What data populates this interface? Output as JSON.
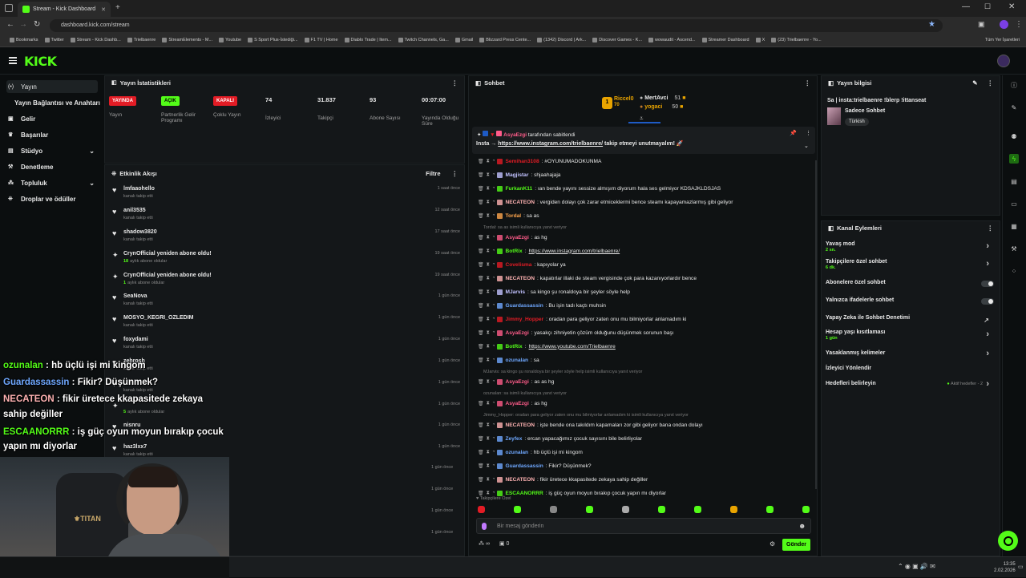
{
  "browser": {
    "tab_title": "Stream - Kick Dashboard",
    "url": "dashboard.kick.com/stream",
    "bookmarks": [
      "Bookmarks",
      "Twitter",
      "Stream - Kick Dashb...",
      "Trielbaenre",
      "StreamElements - M...",
      "Youtube",
      "S Sport Plus-İstediği...",
      "F1 TV | Home",
      "Diablo Trade | Item...",
      "Twitch Channels, Ga...",
      "Gmail",
      "Blizzard Press Cente...",
      "(1342) Discord | Ark...",
      "Discover Games - K...",
      "wowaudit - Ascend...",
      "Streamer Dashboard",
      "X",
      "(23) Trielbaenre - Yo..."
    ],
    "all_bookmarks": "Tüm Yer İşaretleri"
  },
  "sidebar": {
    "items": [
      {
        "label": "Yayın",
        "icon": "broadcast-icon"
      },
      {
        "label": "Yayın Bağlantısı ve Anahtarı",
        "icon": ""
      },
      {
        "label": "Gelir",
        "icon": "money-icon"
      },
      {
        "label": "Başarılar",
        "icon": "trophy-icon"
      },
      {
        "label": "Stüdyo",
        "icon": "studio-icon"
      },
      {
        "label": "Denetleme",
        "icon": "hammer-icon"
      },
      {
        "label": "Topluluk",
        "icon": "community-icon"
      },
      {
        "label": "Droplar ve ödüller",
        "icon": "gift-icon"
      }
    ]
  },
  "stats": {
    "title": "Yayın İstatistikleri",
    "items": [
      {
        "value": "YAYINDA",
        "label": "Yayın",
        "color": "#e31c25",
        "type": "badge"
      },
      {
        "value": "AÇIK",
        "label": "Partnerlik Gelir Programı",
        "color": "#53fc18",
        "type": "badge"
      },
      {
        "value": "KAPALI",
        "label": "Çoklu Yayın",
        "color": "#e31c25",
        "type": "badge"
      },
      {
        "value": "74",
        "label": "İzleyici",
        "type": "num"
      },
      {
        "value": "31.837",
        "label": "Takipçi",
        "type": "num"
      },
      {
        "value": "93",
        "label": "Abone Sayısı",
        "type": "num"
      },
      {
        "value": "00:07:00",
        "label": "Yayında Olduğu Süre",
        "type": "num"
      }
    ]
  },
  "activity": {
    "title": "Etkinlik Akışı",
    "filter": "Filtre",
    "rows": [
      {
        "name": "lmfaaohello",
        "sub": "kanalı takip etti",
        "time": "1 saat önce",
        "kind": "follow"
      },
      {
        "name": "anil3535",
        "sub": "kanalı takip etti",
        "time": "12 saat önce",
        "kind": "follow"
      },
      {
        "name": "shadow3820",
        "sub": "kanalı takip etti",
        "time": "17 saat önce",
        "kind": "follow"
      },
      {
        "name": "CrynOfficial yeniden abone oldu!",
        "sub_num": "18",
        "sub": "aylık abone oldular",
        "time": "19 saat önce",
        "kind": "sub"
      },
      {
        "name": "CrynOfficial yeniden abone oldu!",
        "sub_num": "1",
        "sub": "aylık abone oldular",
        "time": "19 saat önce",
        "kind": "sub"
      },
      {
        "name": "SeaNova",
        "sub": "kanalı takip etti",
        "time": "1 gün önce",
        "kind": "follow"
      },
      {
        "name": "MOSYO_KEGRI_OZLEDIM",
        "sub": "kanalı takip etti",
        "time": "1 gün önce",
        "kind": "follow"
      },
      {
        "name": "foxydami",
        "sub": "kanalı takip etti",
        "time": "1 gün önce",
        "kind": "follow"
      },
      {
        "name": "zehrosh",
        "sub": "kanalı takip etti",
        "time": "1 gün önce",
        "kind": "follow"
      },
      {
        "name": "",
        "sub": "kanalı takip etti",
        "time": "1 gün önce",
        "kind": "follow"
      },
      {
        "name": "",
        "sub_num": "5",
        "sub": "aylık abone oldular",
        "time": "1 gün önce",
        "kind": "sub"
      },
      {
        "name": "nisnru",
        "sub": "",
        "time": "1 gün önce",
        "kind": "follow"
      },
      {
        "name": "haz3lxx7",
        "sub": "kanalı takip etti",
        "time": "1 gün önce",
        "kind": "follow"
      }
    ],
    "more_times": [
      "1 gün önce",
      "1 gün önce",
      "1 gün önce",
      "1 gün önce"
    ]
  },
  "chat": {
    "title": "Sohbet",
    "top_users": [
      {
        "name": "Riccel0",
        "count": "70",
        "color": "#e9a400"
      },
      {
        "name": "MertAvci",
        "count": "51"
      },
      {
        "name": "yogaci",
        "count": "50"
      }
    ],
    "pinned": {
      "by": "AsyaEzgi",
      "by_suffix": "tarafından sabitlendi",
      "prefix": "Insta →",
      "link": "https://www.instagram.com/trielbaenre/",
      "suffix": "takip etmeyi unutmayalım!"
    },
    "messages": [
      {
        "user": "Semihan3108",
        "color": "#e31c25",
        "text": ": #OYUNUMADOKUNMA"
      },
      {
        "user": "Magjistar",
        "color": "#c2c2ff",
        "text": ": shjaahajaja"
      },
      {
        "user": "FurkanK11",
        "color": "#53fc18",
        "text": ": ıan bende yayını sessize almışım diyorum hala ses gelmiyor KDSAJKLDSJAS"
      },
      {
        "user": "NECATEON",
        "color": "#ffb3b3",
        "text": ": vergiden dolayı çok zarar etmiceklermi bence steamı kapayamazlarmış gibi geliyor"
      },
      {
        "user": "Tordal",
        "color": "#ffa64d",
        "text": ": sa as"
      },
      {
        "reply": "Tordal: sa as isimli kullanıcıya yanıt veriyor"
      },
      {
        "user": "AsyaEzgi",
        "color": "#ff5c8a",
        "text": ": as hg"
      },
      {
        "user": "BotRix",
        "color": "#53fc18",
        "text": ": ",
        "link": "https://www.instagram.com/trielbaenre/"
      },
      {
        "user": "Covelisma",
        "color": "#e31c25",
        "text": ": kapıyolar ya"
      },
      {
        "user": "NECATEON",
        "color": "#ffb3b3",
        "text": ": kapatırlar illaki de steam vergisinde çok para kazanıyorlardır bence"
      },
      {
        "user": "MJarvis",
        "color": "#c2c2ff",
        "text": ": sa kingo şu ronaldoya bir şeyler söyle help"
      },
      {
        "user": "Guardassassin",
        "color": "#6fa8ff",
        "text": ": Bu işin tadı kaçtı muhsin"
      },
      {
        "user": "Jimmy_Hopper",
        "color": "#e31c25",
        "text": ": oradan para geliyor zaten onu mu bilmiyorlar anlamadım ki"
      },
      {
        "user": "AsyaEzgi",
        "color": "#ff5c8a",
        "text": ": yasakçı zihniyetin çözüm olduğunu düşünmek sorunun başı"
      },
      {
        "user": "BotRix",
        "color": "#53fc18",
        "text": ": ",
        "link": "https://www.youtube.com/Trielbaenre"
      },
      {
        "user": "ozunalan",
        "color": "#6fa8ff",
        "text": ": sa"
      },
      {
        "reply": "MJarvis: sa kingo şu ronaldoya bir şeyler söyle help isimli kullanıcıya yanıt veriyor"
      },
      {
        "user": "AsyaEzgi",
        "color": "#ff5c8a",
        "text": ": as as hg"
      },
      {
        "reply": "ozunalan: sa isimli kullanıcıya yanıt veriyor"
      },
      {
        "user": "AsyaEzgi",
        "color": "#ff5c8a",
        "text": ": as hg"
      },
      {
        "reply": "Jimmy_Hopper: oradan para geliyor zaten onu mu bilmiyorlar anlamadım ki isimli kullanıcıya yanıt veriyor"
      },
      {
        "user": "NECATEON",
        "color": "#ffb3b3",
        "text": ": işte bende ona takıldım kapamaları zor gibi geliyor bana ondan dolayı"
      },
      {
        "user": "Zeyfex",
        "color": "#6fa8ff",
        "text": ": ercan yapacağımız çocuk sayısını bile belirliyolar"
      },
      {
        "user": "ozunalan",
        "color": "#6fa8ff",
        "text": ": hb üçlü işi mi kingom"
      },
      {
        "user": "Guardassassin",
        "color": "#6fa8ff",
        "text": ": Fikir? Düşünmek?"
      },
      {
        "user": "NECATEON",
        "color": "#ffb3b3",
        "text": ": fikir üretece kkapasitede zekaya sahip değiller"
      },
      {
        "user": "ESCAANORRR",
        "color": "#53fc18",
        "text": ": iş güç oyun moyun bırakıp çocuk yapın mı diyorlar"
      }
    ],
    "followers_only": "Takipçilere Özel",
    "input_placeholder": "Bir mesaj gönderin",
    "infinity": "∞",
    "zero": "0",
    "send": "Gönder"
  },
  "stream_info": {
    "title": "Yayın bilgisi",
    "stream_title": "Sa | insta:trielbaenre !blerp !ittanseat",
    "category": "Sadece Sohbet",
    "language": "Türkish"
  },
  "channel_actions": {
    "title": "Kanal Eylemleri",
    "items": [
      {
        "label": "Yavaş mod",
        "sub": "2 sn.",
        "type": "chevron"
      },
      {
        "label": "Takipçilere özel sohbet",
        "sub": "6 dk.",
        "type": "chevron"
      },
      {
        "label": "Abonelere özel sohbet",
        "sub": "",
        "type": "toggle"
      },
      {
        "label": "Yalnızca ifadelerle sohbet",
        "sub": "",
        "type": "toggle"
      },
      {
        "label": "Yapay Zeka ile Sohbet Denetimi",
        "sub": "",
        "type": "external"
      },
      {
        "label": "Hesap yaşı kısıtlaması",
        "sub": "1 gün",
        "type": "chevron"
      },
      {
        "label": "Yasaklanmış kelimeler",
        "sub": "",
        "type": "chevron"
      },
      {
        "label": "İzleyici Yönlendir",
        "sub": "",
        "type": "none"
      },
      {
        "label": "Hedefleri belirleyin",
        "sub": "",
        "type": "goal",
        "goal_text": "Aktif hedefler - 2"
      }
    ]
  },
  "overlay": {
    "lines": [
      {
        "user": "ozunalan",
        "text": " : hb üçlü işi mi kingom",
        "color": "#53fc18"
      },
      {
        "user": "Guardassassin",
        "text": " : Fikir? Düşünmek?",
        "color": "#6fa8ff"
      },
      {
        "user": "NECATEON",
        "text": " : fikir üretece kkapasitede zekaya",
        "color": "#ffb3b3"
      },
      {
        "user": "",
        "text": "sahip değiller",
        "color": "#fff"
      },
      {
        "user": "ESCAANORRR",
        "text": " : iş güç oyun moyun bırakıp çocuk",
        "color": "#53fc18"
      },
      {
        "user": "",
        "text": "yapın mı diyorlar",
        "color": "#fff"
      }
    ]
  },
  "taskbar": {
    "time": "13:35",
    "date": "2.02.2026"
  }
}
